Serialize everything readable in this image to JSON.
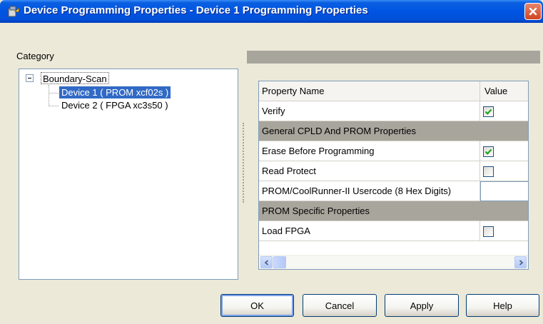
{
  "window": {
    "title": "Device Programming Properties - Device 1 Programming Properties"
  },
  "category": {
    "label": "Category",
    "tree": {
      "root": "Boundary-Scan",
      "children": [
        {
          "label": "Device 1 ( PROM xcf02s )",
          "selected": true
        },
        {
          "label": "Device 2 ( FPGA xc3s50 )",
          "selected": false
        }
      ]
    }
  },
  "grid": {
    "header": {
      "name": "Property Name",
      "value": "Value"
    },
    "rows": [
      {
        "type": "property",
        "name": "Verify",
        "control": "checkbox",
        "checked": true
      },
      {
        "type": "category",
        "name": "General CPLD And PROM Properties"
      },
      {
        "type": "property",
        "name": "Erase Before Programming",
        "control": "checkbox",
        "checked": true
      },
      {
        "type": "property",
        "name": "Read Protect",
        "control": "checkbox",
        "checked": false
      },
      {
        "type": "property",
        "name": "PROM/CoolRunner-II Usercode (8 Hex Digits)",
        "control": "text",
        "value": ""
      },
      {
        "type": "category",
        "name": "PROM Specific Properties"
      },
      {
        "type": "property",
        "name": "Load FPGA",
        "control": "checkbox",
        "checked": false
      }
    ]
  },
  "buttons": {
    "ok": "OK",
    "cancel": "Cancel",
    "apply": "Apply",
    "help": "Help"
  },
  "colors": {
    "title_bar": "#0054e3",
    "selection": "#316ac5",
    "category_row": "#a8a69c",
    "checkmark": "#21a121"
  },
  "icons": {
    "title": "device-programming-icon",
    "close": "close-icon",
    "expander": "tree-collapse-icon",
    "check": "checkmark-icon",
    "scroll_left": "arrow-left-icon",
    "scroll_right": "arrow-right-icon"
  }
}
